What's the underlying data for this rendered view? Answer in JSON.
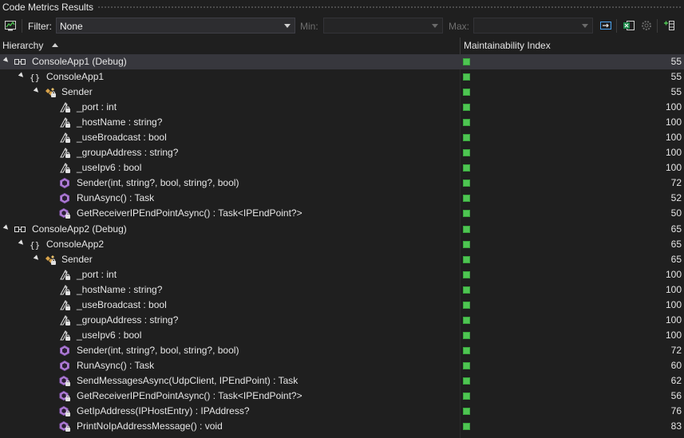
{
  "window": {
    "title": "Code Metrics Results"
  },
  "toolbar": {
    "filter_label": "Filter:",
    "filter_value": "None",
    "min_label": "Min:",
    "min_value": "",
    "max_label": "Max:",
    "max_value": ""
  },
  "header": {
    "hierarchy": "Hierarchy",
    "maintainability": "Maintainability Index"
  },
  "colors": {
    "good": "#4ec552",
    "background": "#1f1f1f",
    "selected_row": "#37373d"
  },
  "rows": [
    {
      "level": 0,
      "kind": "project",
      "icon": "project-icon",
      "expanded": true,
      "name": "ConsoleApp1 (Debug)",
      "mi": "55",
      "selected": true
    },
    {
      "level": 1,
      "kind": "namespace",
      "icon": "namespace-icon",
      "expanded": true,
      "name": "ConsoleApp1",
      "mi": "55"
    },
    {
      "level": 2,
      "kind": "class",
      "icon": "class-icon",
      "expanded": true,
      "name": "Sender",
      "mi": "55"
    },
    {
      "level": 3,
      "kind": "field",
      "icon": "private-field-icon",
      "name": "_port : int",
      "mi": "100"
    },
    {
      "level": 3,
      "kind": "field",
      "icon": "private-field-icon",
      "name": "_hostName : string?",
      "mi": "100"
    },
    {
      "level": 3,
      "kind": "field",
      "icon": "private-field-icon",
      "name": "_useBroadcast : bool",
      "mi": "100"
    },
    {
      "level": 3,
      "kind": "field",
      "icon": "private-field-icon",
      "name": "_groupAddress : string?",
      "mi": "100"
    },
    {
      "level": 3,
      "kind": "field",
      "icon": "private-field-icon",
      "name": "_useIpv6 : bool",
      "mi": "100"
    },
    {
      "level": 3,
      "kind": "method",
      "icon": "method-icon",
      "name": "Sender(int, string?, bool, string?, bool)",
      "mi": "72"
    },
    {
      "level": 3,
      "kind": "method",
      "icon": "method-icon",
      "name": "RunAsync() : Task",
      "mi": "52"
    },
    {
      "level": 3,
      "kind": "private-method",
      "icon": "private-method-icon",
      "name": "GetReceiverIPEndPointAsync() : Task<IPEndPoint?>",
      "mi": "50"
    },
    {
      "level": 0,
      "kind": "project",
      "icon": "project-icon",
      "expanded": true,
      "name": "ConsoleApp2 (Debug)",
      "mi": "65"
    },
    {
      "level": 1,
      "kind": "namespace",
      "icon": "namespace-icon",
      "expanded": true,
      "name": "ConsoleApp2",
      "mi": "65"
    },
    {
      "level": 2,
      "kind": "class",
      "icon": "class-icon",
      "expanded": true,
      "name": "Sender",
      "mi": "65"
    },
    {
      "level": 3,
      "kind": "field",
      "icon": "private-field-icon",
      "name": "_port : int",
      "mi": "100"
    },
    {
      "level": 3,
      "kind": "field",
      "icon": "private-field-icon",
      "name": "_hostName : string?",
      "mi": "100"
    },
    {
      "level": 3,
      "kind": "field",
      "icon": "private-field-icon",
      "name": "_useBroadcast : bool",
      "mi": "100"
    },
    {
      "level": 3,
      "kind": "field",
      "icon": "private-field-icon",
      "name": "_groupAddress : string?",
      "mi": "100"
    },
    {
      "level": 3,
      "kind": "field",
      "icon": "private-field-icon",
      "name": "_useIpv6 : bool",
      "mi": "100"
    },
    {
      "level": 3,
      "kind": "method",
      "icon": "method-icon",
      "name": "Sender(int, string?, bool, string?, bool)",
      "mi": "72"
    },
    {
      "level": 3,
      "kind": "method",
      "icon": "method-icon",
      "name": "RunAsync() : Task",
      "mi": "60"
    },
    {
      "level": 3,
      "kind": "private-method",
      "icon": "private-method-icon",
      "name": "SendMessagesAsync(UdpClient, IPEndPoint) : Task",
      "mi": "62"
    },
    {
      "level": 3,
      "kind": "private-method",
      "icon": "private-method-icon",
      "name": "GetReceiverIPEndPointAsync() : Task<IPEndPoint?>",
      "mi": "56"
    },
    {
      "level": 3,
      "kind": "private-method",
      "icon": "private-method-icon",
      "name": "GetIpAddress(IPHostEntry) : IPAddress?",
      "mi": "76"
    },
    {
      "level": 3,
      "kind": "private-method",
      "icon": "private-method-icon",
      "name": "PrintNoIpAddressMessage() : void",
      "mi": "83"
    }
  ]
}
